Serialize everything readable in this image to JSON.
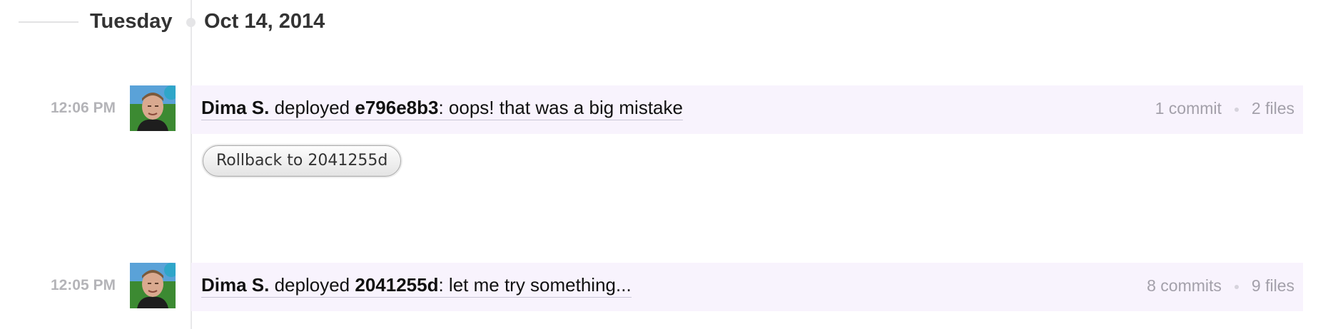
{
  "date_header": {
    "day": "Tuesday",
    "date": "Oct 14, 2014"
  },
  "deploys": [
    {
      "time": "12:06 PM",
      "user": "Dima S.",
      "action": " deployed ",
      "revision": "e796e8b3",
      "message": ": oops! that was a big mistake",
      "commits": "1 commit",
      "files": "2 files"
    },
    {
      "time": "12:05 PM",
      "user": "Dima S.",
      "action": " deployed ",
      "revision": "2041255d",
      "message": ": let me try something...",
      "commits": "8 commits",
      "files": "9 files"
    }
  ],
  "rollback": {
    "label": "Rollback to 2041255d"
  },
  "colors": {
    "row_background": "#f8f3fd",
    "timeline": "#e8e8ea",
    "muted_text": "#a3a0aa"
  }
}
